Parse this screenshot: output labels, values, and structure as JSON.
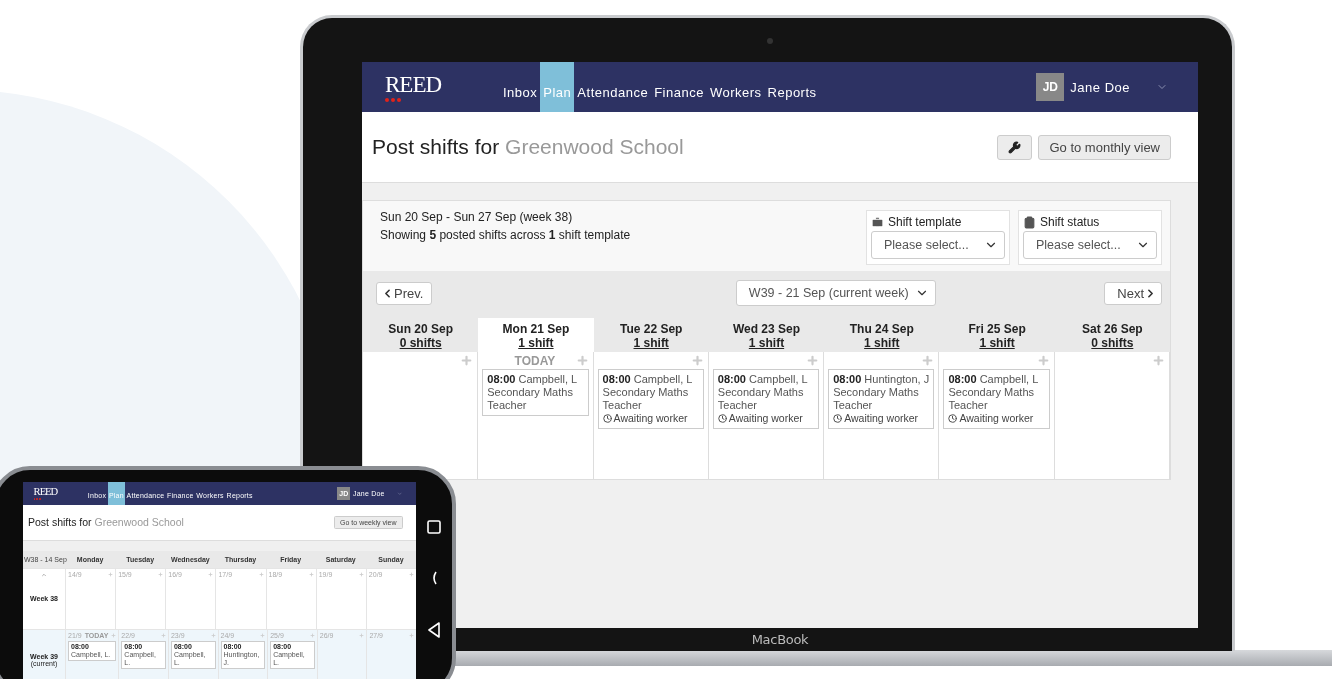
{
  "laptop": {
    "brand": "MacBook",
    "app": {
      "logo": "REED",
      "nav": [
        {
          "label": "Inbox",
          "selected": false
        },
        {
          "label": "Plan",
          "selected": true
        },
        {
          "label": "Attendance",
          "selected": false
        },
        {
          "label": "Finance",
          "selected": false
        },
        {
          "label": "Workers",
          "selected": false
        },
        {
          "label": "Reports",
          "selected": false
        }
      ],
      "user": {
        "initials": "JD",
        "name": "Jane Doe"
      },
      "title": "Post shifts for",
      "place": "Greenwood School",
      "view_button": "Go to monthly view",
      "summary": {
        "range": "Sun 20 Sep - Sun 27 Sep (week 38)",
        "showing": "Showing **5** posted shifts across **1** shift template"
      },
      "filters": [
        {
          "kind": "template",
          "label": "Shift template",
          "value": "Please select..."
        },
        {
          "kind": "status",
          "label": "Shift status",
          "value": "Please select..."
        }
      ],
      "week_nav": {
        "prev": "Prev.",
        "week": "W39 - 21 Sep (current week)",
        "next": "Next"
      },
      "days": [
        {
          "name": "Sun 20 Sep",
          "count": "0 shifts",
          "today": false
        },
        {
          "name": "Mon 21 Sep",
          "count": "1 shift",
          "today": true,
          "badge": "TODAY",
          "shifts": [
            {
              "time": "08:00",
              "worker": "Campbell, L",
              "role": "Secondary Maths Teacher"
            }
          ]
        },
        {
          "name": "Tue 22 Sep",
          "count": "1 shift",
          "today": false,
          "shifts": [
            {
              "time": "08:00",
              "worker": "Campbell, L",
              "role": "Secondary Maths Teacher",
              "status": "Awaiting worker"
            }
          ]
        },
        {
          "name": "Wed 23 Sep",
          "count": "1 shift",
          "today": false,
          "shifts": [
            {
              "time": "08:00",
              "worker": "Campbell, L",
              "role": "Secondary Maths Teacher",
              "status": "Awaiting worker"
            }
          ]
        },
        {
          "name": "Thu 24 Sep",
          "count": "1 shift",
          "today": false,
          "shifts": [
            {
              "time": "08:00",
              "worker": "Huntington, J",
              "role": "Secondary Maths Teacher",
              "status": "Awaiting worker"
            }
          ]
        },
        {
          "name": "Fri 25 Sep",
          "count": "1 shift",
          "today": false,
          "shifts": [
            {
              "time": "08:00",
              "worker": "Campbell, L",
              "role": "Secondary Maths Teacher",
              "status": "Awaiting worker"
            }
          ]
        },
        {
          "name": "Sat 26 Sep",
          "count": "0 shifts",
          "today": false
        }
      ]
    }
  },
  "phone": {
    "app": {
      "logo": "REED",
      "nav": [
        {
          "label": "Inbox",
          "selected": false
        },
        {
          "label": "Plan",
          "selected": true
        },
        {
          "label": "Attendance",
          "selected": false
        },
        {
          "label": "Finance",
          "selected": false
        },
        {
          "label": "Workers",
          "selected": false
        },
        {
          "label": "Reports",
          "selected": false
        }
      ],
      "user": {
        "initials": "JD",
        "name": "Jane Doe"
      },
      "title": "Post shifts for",
      "place": "Greenwood School",
      "view_button": "Go to weekly view",
      "week_select": "W38 - 14 Sep",
      "weekdays": [
        "Monday",
        "Tuesday",
        "Wednesday",
        "Thursday",
        "Friday",
        "Saturday",
        "Sunday"
      ],
      "weeks": [
        {
          "label": "Week 38",
          "current": false,
          "days": [
            {
              "date": "14/9"
            },
            {
              "date": "15/9"
            },
            {
              "date": "16/9"
            },
            {
              "date": "17/9"
            },
            {
              "date": "18/9"
            },
            {
              "date": "19/9"
            },
            {
              "date": "20/9"
            }
          ]
        },
        {
          "label": "Week 39",
          "note": "(current)",
          "current": true,
          "days": [
            {
              "date": "21/9",
              "badge": "TODAY",
              "shifts": [
                {
                  "time": "08:00",
                  "worker": "Campbell, L."
                }
              ]
            },
            {
              "date": "22/9",
              "shifts": [
                {
                  "time": "08:00",
                  "worker": "Campbell, L."
                }
              ]
            },
            {
              "date": "23/9",
              "shifts": [
                {
                  "time": "08:00",
                  "worker": "Campbell, L."
                }
              ]
            },
            {
              "date": "24/9",
              "shifts": [
                {
                  "time": "08:00",
                  "worker": "Huntington, J."
                }
              ]
            },
            {
              "date": "25/9",
              "shifts": [
                {
                  "time": "08:00",
                  "worker": "Campbell, L."
                }
              ]
            },
            {
              "date": "26/9"
            },
            {
              "date": "27/9"
            }
          ]
        }
      ]
    }
  }
}
